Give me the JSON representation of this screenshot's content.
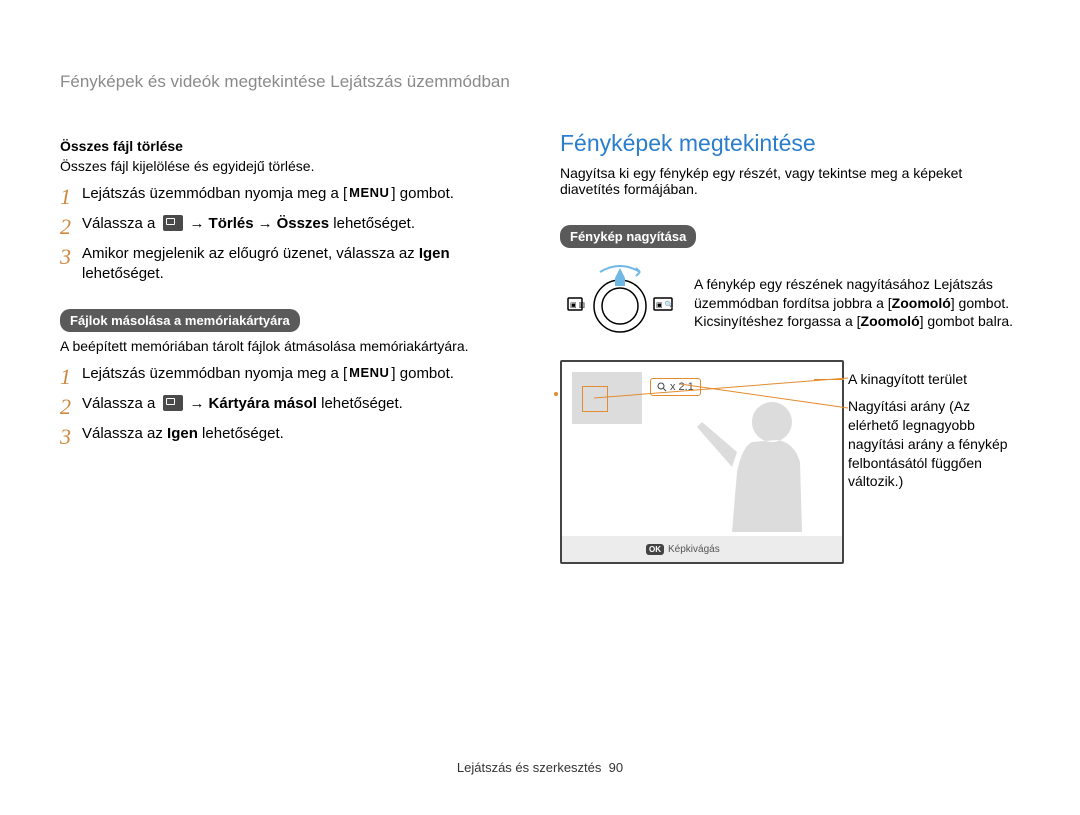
{
  "breadcrumb": "Fényképek és videók megtekintése Lejátszás üzemmódban",
  "left": {
    "delete_all_title": "Összes fájl törlése",
    "delete_all_desc": "Összes fájl kijelölése és egyidejű törlése.",
    "steps_a": {
      "s1_a": "Lejátszás üzemmódban nyomja meg a [",
      "menu": "MENU",
      "s1_b": "] gombot.",
      "s2_a": "Válassza a ",
      "s2_b": "Törlés",
      "s2_c": "Összes",
      "s2_d": " lehetőséget.",
      "s3_a": "Amikor megjelenik az előugró üzenet, válassza az ",
      "s3_b": "Igen",
      "s3_c": " lehetőséget."
    },
    "copy_title": "Fájlok másolása a memóriakártyára",
    "copy_desc": "A beépített memóriában tárolt fájlok átmásolása memóriakártyára.",
    "steps_b": {
      "s1_a": "Lejátszás üzemmódban nyomja meg a [",
      "menu": "MENU",
      "s1_b": "] gombot.",
      "s2_a": "Válassza a ",
      "s2_b": "Kártyára másol",
      "s2_c": " lehetőséget.",
      "s3_a": "Válassza az ",
      "s3_b": "Igen",
      "s3_c": " lehetőséget."
    }
  },
  "right": {
    "title": "Fényképek megtekintése",
    "intro": "Nagyítsa ki egy fénykép egy részét, vagy tekintse meg a képeket diavetítés formájában.",
    "zoom_badge": "Fénykép nagyítása",
    "zoom_p_a": "A fénykép egy részének nagyításához Lejátszás üzemmódban fordítsa jobbra a [",
    "zoom_p_b": "Zoomoló",
    "zoom_p_c": "] gombot. Kicsinyítéshez forgassa a [",
    "zoom_p_d": "Zoomoló",
    "zoom_p_e": "] gombot balra.",
    "annot1": "A kinagyított terület",
    "annot2": "Nagyítási arány (Az elérhető legnagyobb nagyítási arány a fénykép felbontásától függően változik.)",
    "zoom_label": "x 2.1",
    "crop_label": "Képkivágás",
    "ok_label": "OK"
  },
  "footer": {
    "section": "Lejátszás és szerkesztés",
    "page": "90"
  }
}
